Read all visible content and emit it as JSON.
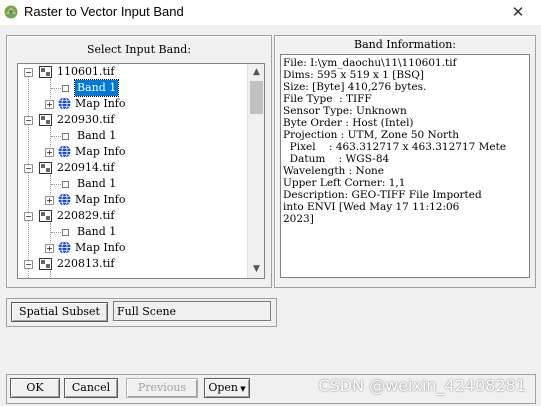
{
  "window": {
    "title": "Raster to Vector Input Band",
    "close_glyph": "✕"
  },
  "left_panel": {
    "title": "Select Input Band:",
    "tree": [
      {
        "file": "110601.tif",
        "band": "Band 1",
        "map_info": "Map Info",
        "band_selected": true
      },
      {
        "file": "220930.tif",
        "band": "Band 1",
        "map_info": "Map Info",
        "band_selected": false
      },
      {
        "file": "220914.tif",
        "band": "Band 1",
        "map_info": "Map Info",
        "band_selected": false
      },
      {
        "file": "220829.tif",
        "band": "Band 1",
        "map_info": "Map Info",
        "band_selected": false
      },
      {
        "file": "220813.tif"
      }
    ]
  },
  "right_panel": {
    "title": "Band Information:",
    "lines": [
      "File: I:\\ym_daochu\\11\\110601.tif",
      "Dims: 595 x 519 x 1 [BSQ]",
      "Size: [Byte] 410,276 bytes.",
      "File Type  : TIFF",
      "Sensor Type: Unknown",
      "Byte Order : Host (Intel)",
      "Projection : UTM, Zone 50 North",
      "  Pixel    : 463.312717 x 463.312717 Mete",
      "  Datum    : WGS-84",
      "Wavelength : None",
      "Upper Left Corner: 1,1",
      "Description: GEO-TIFF File Imported",
      "into ENVI [Wed May 17 11:12:06",
      "2023]"
    ]
  },
  "spatial_subset": {
    "button_label": "Spatial Subset",
    "value": "Full Scene"
  },
  "buttons": {
    "ok": "OK",
    "cancel": "Cancel",
    "previous": "Previous",
    "open": "Open"
  },
  "watermark": "CSDN @weixin_42408281",
  "colors": {
    "selection": "#0078d7",
    "background": "#f0f0f0"
  }
}
